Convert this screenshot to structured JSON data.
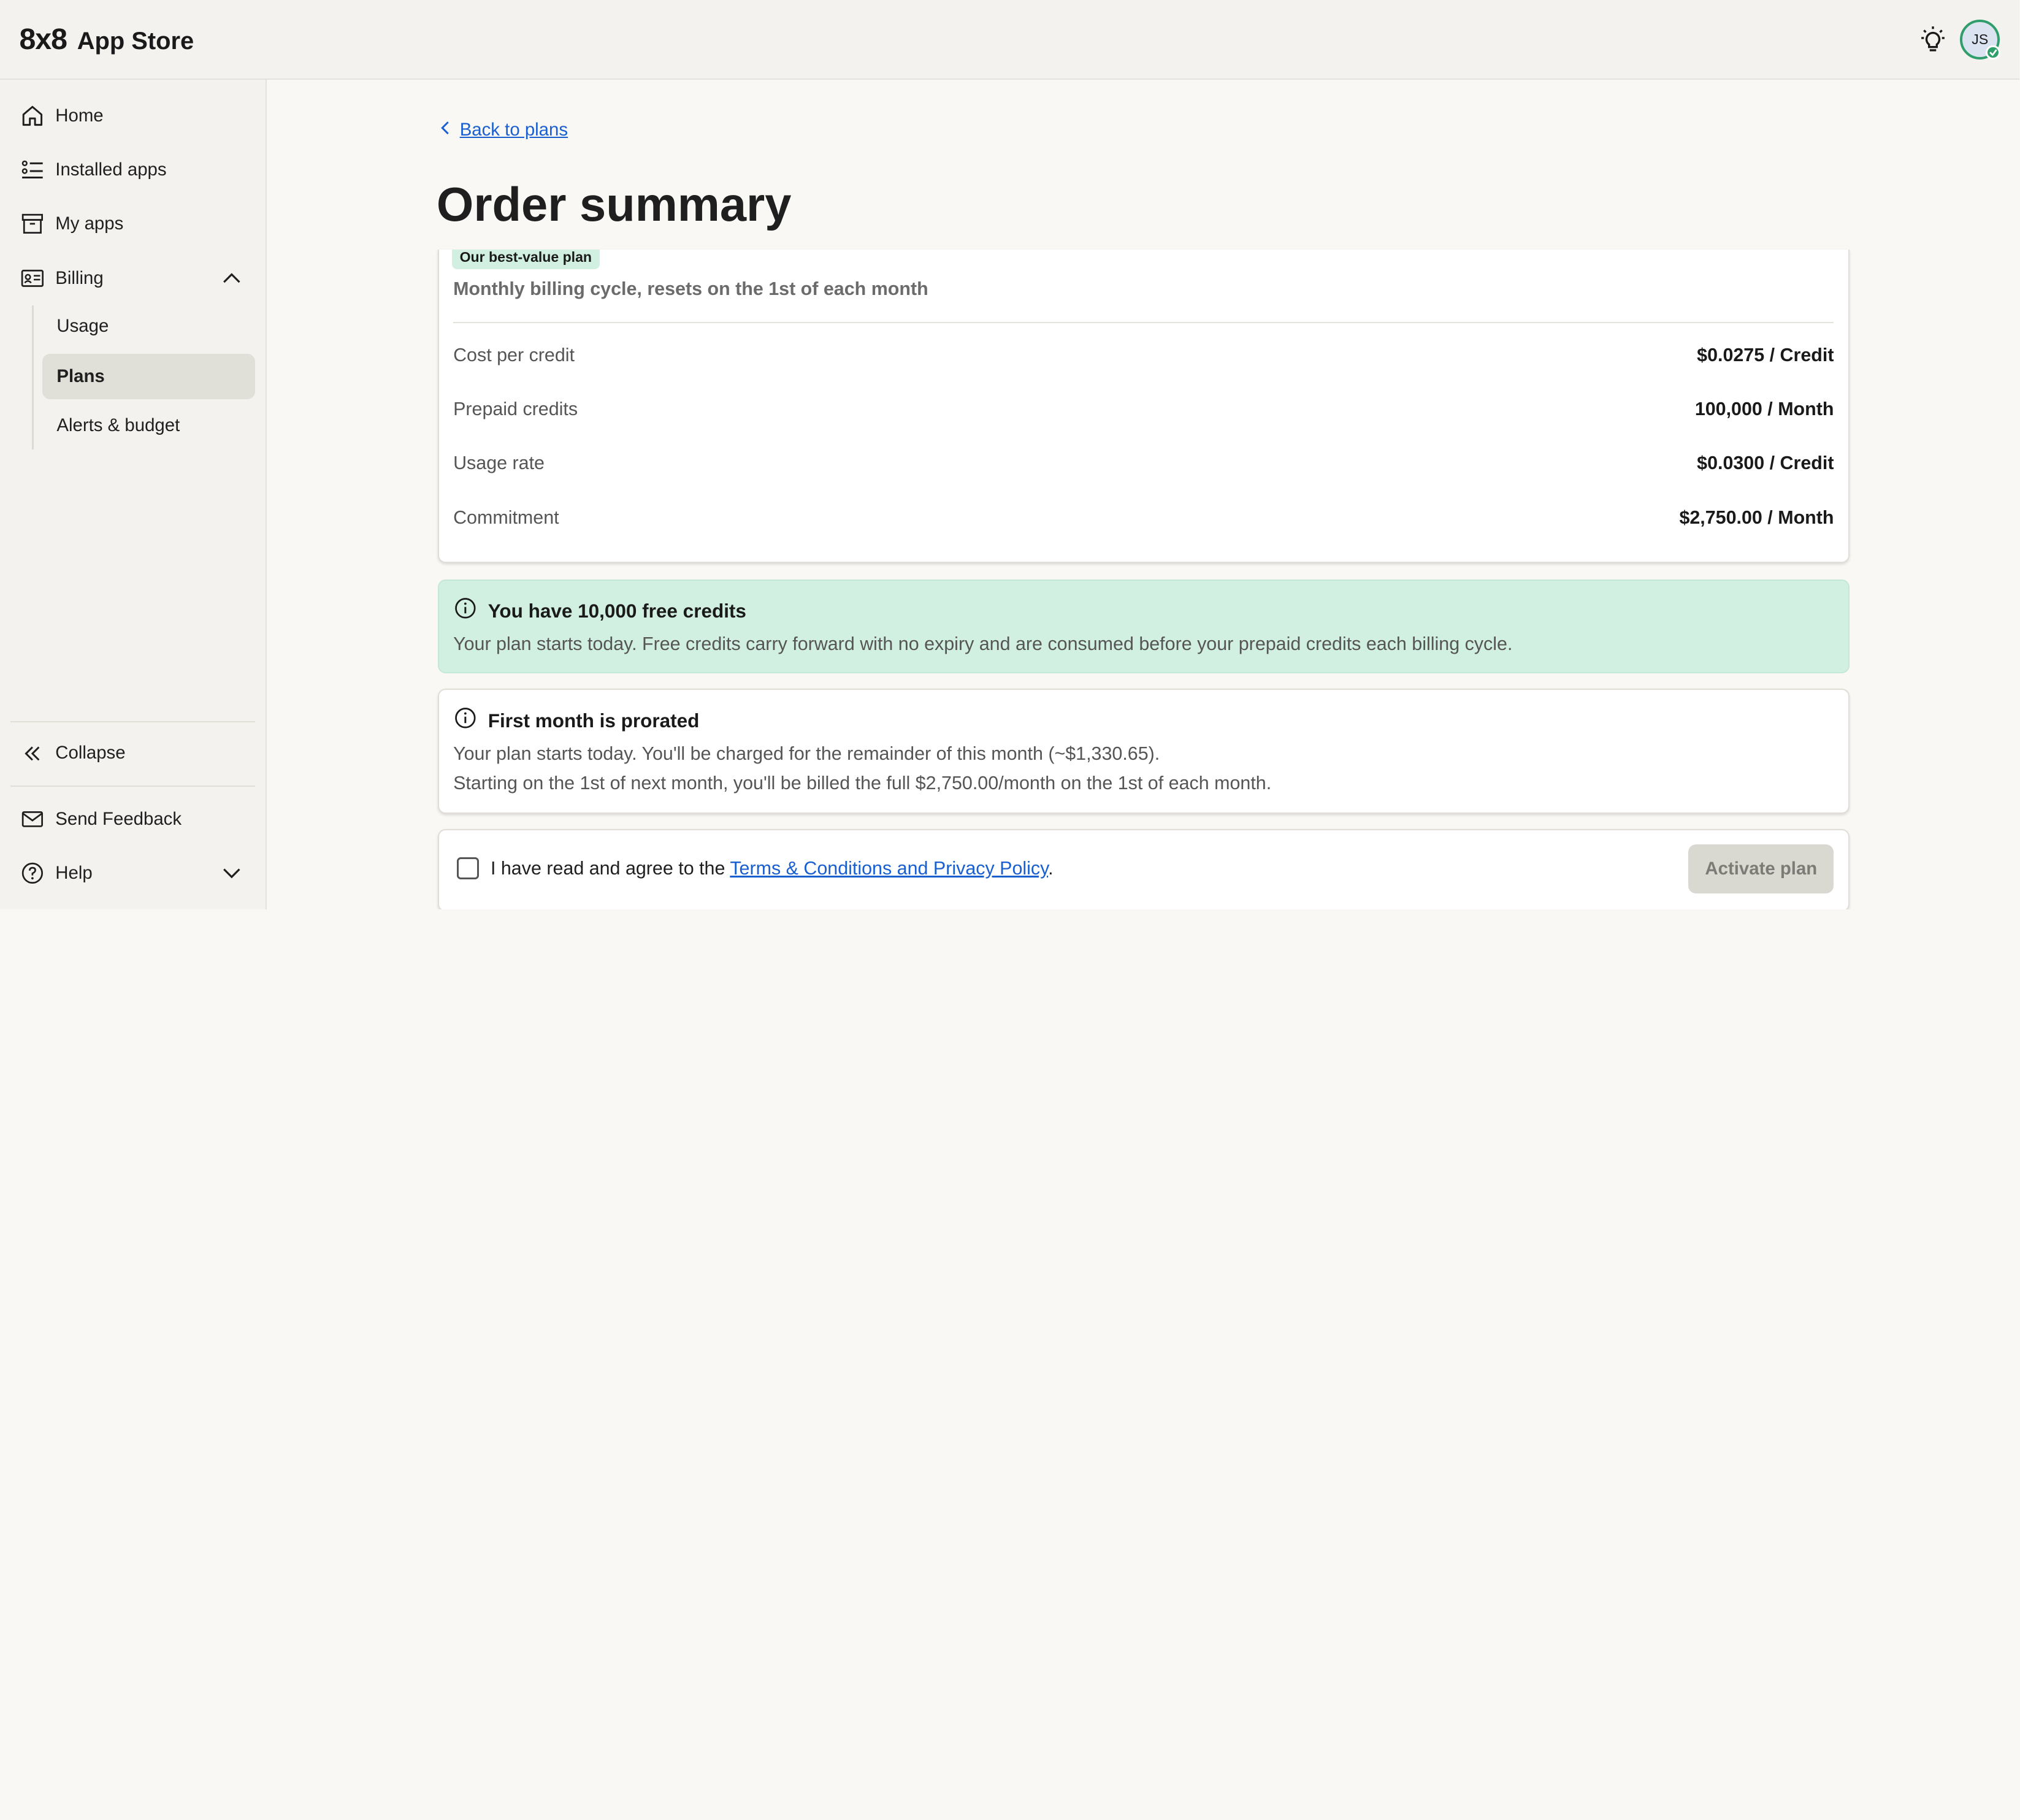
{
  "header": {
    "logo": "8x8",
    "title": "App Store",
    "user_initials": "JS"
  },
  "sidebar": {
    "items": [
      {
        "label": "Home",
        "icon": "home-icon"
      },
      {
        "label": "Installed apps",
        "icon": "list-icon"
      },
      {
        "label": "My apps",
        "icon": "archive-icon"
      },
      {
        "label": "Billing",
        "icon": "id-card-icon",
        "expanded": true
      }
    ],
    "billing_sub": [
      {
        "label": "Usage",
        "active": false
      },
      {
        "label": "Plans",
        "active": true
      },
      {
        "label": "Alerts & budget",
        "active": false
      }
    ],
    "collapse_label": "Collapse",
    "feedback_label": "Send Feedback",
    "help_label": "Help"
  },
  "main": {
    "back_label": "Back to plans",
    "title": "Order summary",
    "plan": {
      "badge": "Our best-value plan",
      "cycle": "Monthly billing cycle, resets on the 1st of each month",
      "rows": [
        {
          "label": "Cost per credit",
          "value": "$0.0275 / Credit"
        },
        {
          "label": "Prepaid credits",
          "value": "100,000 / Month"
        },
        {
          "label": "Usage rate",
          "value": "$0.0300 / Credit"
        },
        {
          "label": "Commitment",
          "value": "$2,750.00 / Month"
        }
      ]
    },
    "free_credits": {
      "title": "You have 10,000 free credits",
      "text": "Your plan starts today. Free credits carry forward with no expiry and are consumed before your prepaid credits each billing cycle."
    },
    "prorated": {
      "title": "First month is prorated",
      "line1": "Your plan starts today. You'll be charged for the remainder of this month (~$1,330.65).",
      "line2": "Starting on the 1st of next month, you'll be billed the full $2,750.00/month on the 1st of each month."
    },
    "agree": {
      "prefix": "I have read and agree to the ",
      "link": "Terms & Conditions and Privacy Policy",
      "suffix": ".",
      "checked": false
    },
    "activate_label": "Activate plan"
  },
  "colors": {
    "accent_link": "#1a5fd0",
    "success_green": "#2f9e6b",
    "info_green_bg": "#d2f0e1"
  }
}
